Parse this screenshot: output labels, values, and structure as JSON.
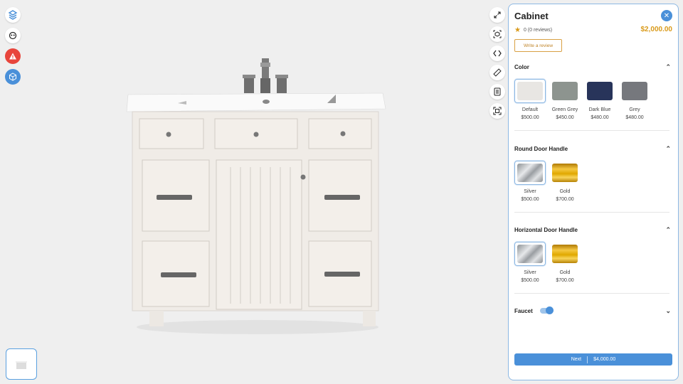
{
  "panel": {
    "title": "Cabinet",
    "rating_text": "0 (0 reviews)",
    "price": "$2,000.00",
    "review_button": "Write a review",
    "close_glyph": "✕"
  },
  "sections": [
    {
      "title": "Color",
      "chevron": "⌃",
      "options": [
        {
          "name": "Default",
          "price": "$500.00",
          "color": "#e8e6e3",
          "selected": true
        },
        {
          "name": "Green Grey",
          "price": "$450.00",
          "color": "#8d948f",
          "selected": false
        },
        {
          "name": "Dark Blue",
          "price": "$480.00",
          "color": "#28345a",
          "selected": false
        },
        {
          "name": "Grey",
          "price": "$480.00",
          "color": "#76787d",
          "selected": false
        }
      ]
    },
    {
      "title": "Round Door Handle",
      "chevron": "⌃",
      "options": [
        {
          "name": "Silver",
          "price": "$500.00",
          "color": "silver",
          "selected": true
        },
        {
          "name": "Gold",
          "price": "$700.00",
          "color": "gold",
          "selected": false
        }
      ]
    },
    {
      "title": "Horizontal Door Handle",
      "chevron": "⌃",
      "options": [
        {
          "name": "Silver",
          "price": "$500.00",
          "color": "silver",
          "selected": true
        },
        {
          "name": "Gold",
          "price": "$700.00",
          "color": "gold",
          "selected": false
        }
      ]
    }
  ],
  "faucet": {
    "title": "Faucet",
    "chevron": "⌄",
    "enabled": true
  },
  "next": {
    "label": "Next",
    "total": "$4,000.00"
  },
  "colors": {
    "accent": "#4a90d9",
    "price": "#d99a1a",
    "warning": "#e8453c"
  },
  "left_tools": [
    "logo-icon",
    "view-icon",
    "warning-icon",
    "cube-icon"
  ],
  "right_tools": [
    "expand-icon",
    "ar-icon",
    "embed-icon",
    "ruler-icon",
    "document-icon",
    "fullscreen-icon"
  ]
}
